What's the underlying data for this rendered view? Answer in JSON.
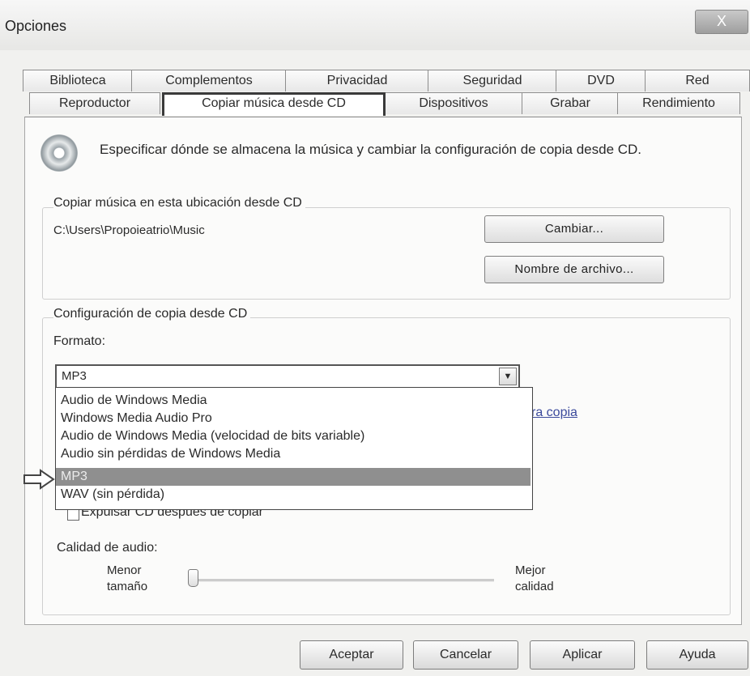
{
  "window": {
    "title": "Opciones",
    "close_label": "X"
  },
  "tabs": {
    "row1": [
      "Biblioteca",
      "Complementos",
      "Privacidad",
      "Seguridad",
      "DVD",
      "Red"
    ],
    "row2": [
      "Reproductor",
      "Copiar música desde CD",
      "Dispositivos",
      "Grabar",
      "Rendimiento"
    ],
    "active": "Copiar música desde CD"
  },
  "description": "Especificar dónde se almacena la música y cambiar la configuración de copia desde CD.",
  "location": {
    "heading": "Copiar música en esta ubicación desde CD",
    "path": "C:\\Users\\Propoieatrio\\Music",
    "change_button": "Cambiar...",
    "filename_button": "Nombre de archivo..."
  },
  "settings": {
    "heading": "Configuración de copia desde CD",
    "format_label": "Formato:",
    "format_value": "MP3",
    "format_options": [
      "Audio de Windows Media",
      "Windows Media Audio Pro",
      "Audio de Windows Media (velocidad de bits variable)",
      "Audio sin pérdidas de Windows Media",
      "MP3",
      "WAV (sin pérdida)"
    ],
    "selected_index": 4,
    "partial_link": "ra copia",
    "eject_label": "Expulsar CD después de copiar",
    "eject_checked": false,
    "quality_label": "Calidad de audio:",
    "min_label": [
      "Menor",
      "tamaño"
    ],
    "max_label": [
      "Mejor",
      "calidad"
    ],
    "quality_level": 0
  },
  "buttons": {
    "ok": "Aceptar",
    "cancel": "Cancelar",
    "apply": "Aplicar",
    "help": "Ayuda"
  },
  "icons": {
    "cd": "cd-icon",
    "pointer": "arrow-right-icon",
    "dropdown": "chevron-down-icon"
  }
}
